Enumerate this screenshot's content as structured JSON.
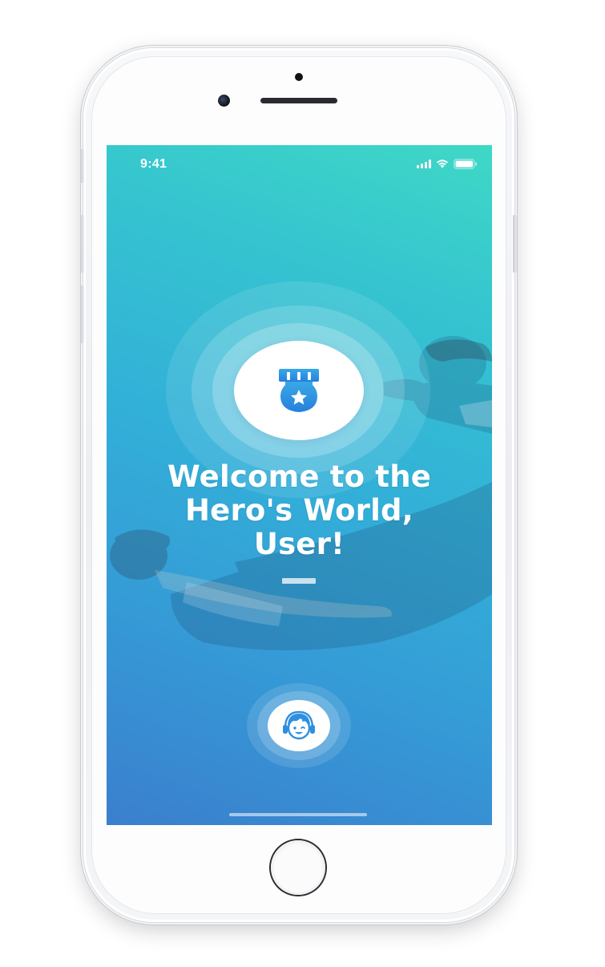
{
  "status_bar": {
    "time": "9:41",
    "icons": [
      "signal-icon",
      "wifi-icon",
      "battery-icon"
    ]
  },
  "welcome": {
    "line1": "Welcome to the",
    "line2": "Hero's World,",
    "line3": "User!"
  },
  "badge": {
    "icon": "medal-star-icon"
  },
  "profile_button": {
    "icon": "boy-headphones-avatar-icon"
  },
  "colors": {
    "gradient_top": "#3fd8c6",
    "gradient_bottom": "#3b7fcd",
    "icon_blue": "#2e8fe0",
    "text": "#ffffff"
  }
}
